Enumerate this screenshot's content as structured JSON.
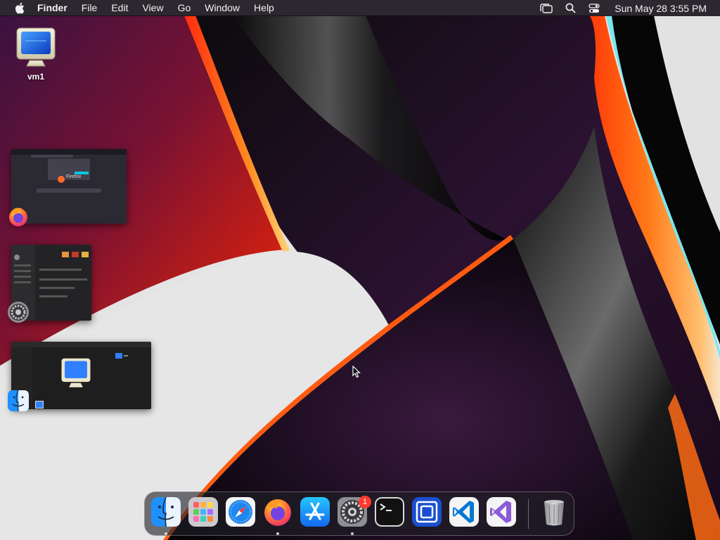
{
  "menubar": {
    "app_name": "Finder",
    "menus": [
      "File",
      "Edit",
      "View",
      "Go",
      "Window",
      "Help"
    ],
    "clock": "Sun May 28  3:55 PM",
    "status_icons": [
      "stage-manager-icon",
      "spotlight-search-icon",
      "control-center-icon"
    ]
  },
  "desktop": {
    "icons": [
      {
        "label": "vm1",
        "icon": "display-monitor-icon"
      }
    ]
  },
  "stage_manager": {
    "groups": [
      {
        "app": "Firefox",
        "icon": "firefox-icon",
        "preview_text": "Firefox"
      },
      {
        "app": "System Settings",
        "icon": "system-settings-icon"
      },
      {
        "app": "Finder",
        "icon": "finder-icon"
      }
    ]
  },
  "dock": {
    "items": [
      {
        "name": "Finder",
        "icon": "finder-icon",
        "running": true
      },
      {
        "name": "Launchpad",
        "icon": "launchpad-icon",
        "running": false
      },
      {
        "name": "Safari",
        "icon": "safari-icon",
        "running": false
      },
      {
        "name": "Firefox",
        "icon": "firefox-icon",
        "running": true
      },
      {
        "name": "App Store",
        "icon": "app-store-icon",
        "running": false
      },
      {
        "name": "System Settings",
        "icon": "system-settings-icon",
        "running": true,
        "badge": "1"
      },
      {
        "name": "Terminal",
        "icon": "terminal-icon",
        "running": false
      },
      {
        "name": "App",
        "icon": "blue-square-app-icon",
        "running": false
      },
      {
        "name": "Visual Studio Code",
        "icon": "vscode-icon",
        "running": false
      },
      {
        "name": "Visual Studio",
        "icon": "visual-studio-icon",
        "running": false
      },
      {
        "name": "Trash",
        "icon": "trash-icon",
        "running": false
      }
    ],
    "system_settings_badge": "1"
  },
  "colors": {
    "menubar_bg": "#120e16",
    "accent_red": "#ff3b30",
    "wallpaper_dark": "#050505",
    "wallpaper_purple": "#2a0f2e",
    "wallpaper_orange": "#ff5a14",
    "wallpaper_light": "#e6e6e6"
  }
}
